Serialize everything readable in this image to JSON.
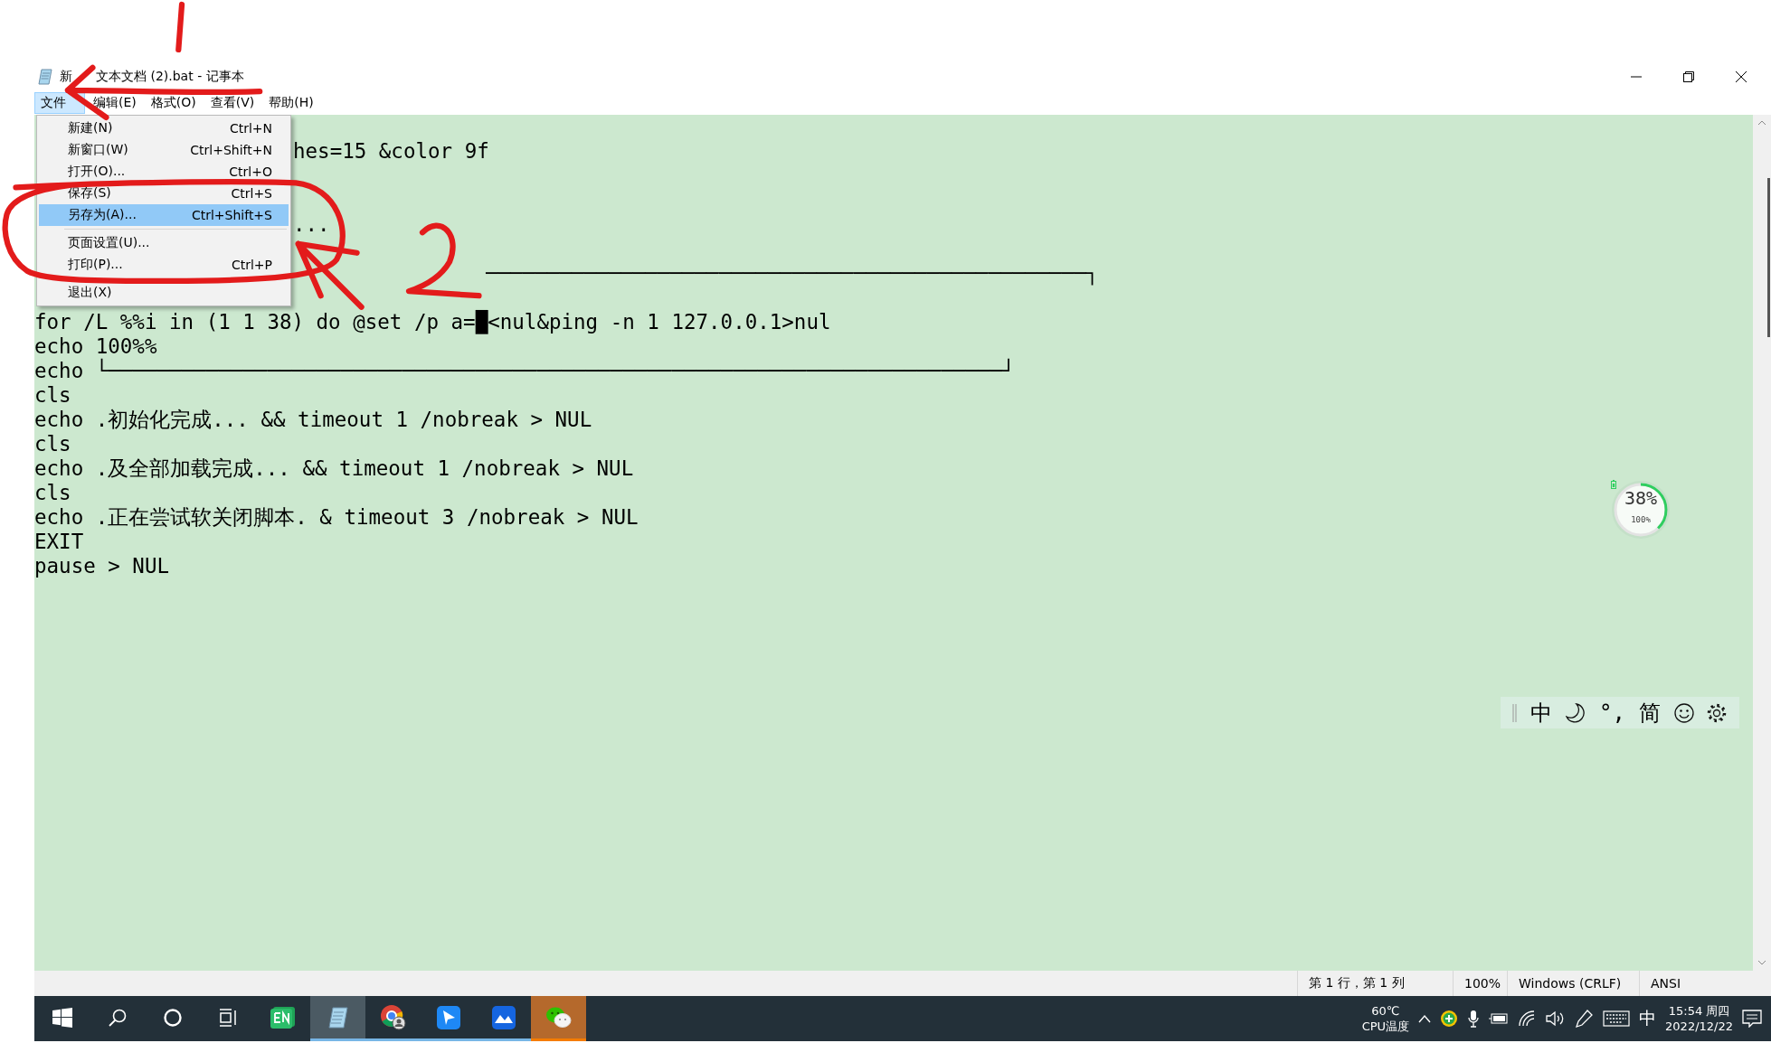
{
  "window": {
    "title": [
      "新",
      "文本文档 (2).bat - 记事本"
    ]
  },
  "menu_bar": [
    {
      "label": "文件",
      "selected": true
    },
    {
      "label": "编辑(E)",
      "selected": false
    },
    {
      "label": "格式(O)",
      "selected": false
    },
    {
      "label": "查看(V)",
      "selected": false
    },
    {
      "label": "帮助(H)",
      "selected": false
    }
  ],
  "file_menu": {
    "items": [
      {
        "kind": "item",
        "label": "新建(N)",
        "shortcut": "Ctrl+N",
        "selected": false
      },
      {
        "kind": "item",
        "label": "新窗口(W)",
        "shortcut": "Ctrl+Shift+N",
        "selected": false
      },
      {
        "kind": "item",
        "label": "打开(O)...",
        "shortcut": "Ctrl+O",
        "selected": false
      },
      {
        "kind": "item",
        "label": "保存(S)",
        "shortcut": "Ctrl+S",
        "selected": false
      },
      {
        "kind": "item",
        "label": "另存为(A)...",
        "shortcut": "Ctrl+Shift+S",
        "selected": true
      },
      {
        "kind": "separator"
      },
      {
        "kind": "item",
        "label": "页面设置(U)...",
        "selected": false
      },
      {
        "kind": "item",
        "label": "打印(P)...",
        "shortcut": "Ctrl+P",
        "selected": false
      },
      {
        "kind": "separator"
      },
      {
        "kind": "item",
        "label": "退出(X)",
        "selected": false
      }
    ]
  },
  "editor": {
    "lines": [
      {
        "kind": "blank"
      },
      {
        "kind": "covered",
        "text": "hes=15 &color 9f"
      },
      {
        "kind": "blank"
      },
      {
        "kind": "blank"
      },
      {
        "kind": "covered",
        "text": "..."
      },
      {
        "kind": "blank"
      },
      {
        "kind": "covered_wide",
        "text": "─────────────────────────────────────────────────┐"
      },
      {
        "kind": "blank"
      },
      {
        "kind": "code",
        "text": "for /L %%i in (1 1 38) do @set /p a=█<nul&ping -n 1 127.0.0.1>nul"
      },
      {
        "kind": "code",
        "text": "echo 100%%"
      },
      {
        "kind": "code",
        "text": "echo └─────────────────────────────────────────────────────────────────────────┘"
      },
      {
        "kind": "code",
        "text": "cls"
      },
      {
        "kind": "code",
        "text": "echo .初始化完成... && timeout 1 /nobreak > NUL"
      },
      {
        "kind": "code",
        "text": "cls"
      },
      {
        "kind": "code",
        "text": "echo .及全部加载完成... && timeout 1 /nobreak > NUL"
      },
      {
        "kind": "code",
        "text": "cls"
      },
      {
        "kind": "code",
        "text": "echo .正在尝试软关闭脚本. & timeout 3 /nobreak > NUL"
      },
      {
        "kind": "code",
        "text": "EXIT"
      },
      {
        "kind": "code",
        "text": "pause > NUL"
      }
    ]
  },
  "battery_widget": {
    "usage": "38%",
    "level": 0.38,
    "battery": "100%"
  },
  "ime_toolbar": {
    "mode": "中",
    "punctuation": "°,",
    "script": "简"
  },
  "status_bar": {
    "position": "第 1 行，第 1 列",
    "zoom": "100%",
    "line_ending": "Windows (CRLF)",
    "encoding": "ANSI"
  },
  "taskbar": {
    "buttons": [
      {
        "kind": "start"
      },
      {
        "kind": "search"
      },
      {
        "kind": "cortana"
      },
      {
        "kind": "task_view"
      }
    ],
    "apps": [
      {
        "kind": "en",
        "selected": false,
        "running": false,
        "flashing": false
      },
      {
        "kind": "notepad",
        "selected": true,
        "running": true,
        "flashing": false
      },
      {
        "kind": "chrome",
        "selected": false,
        "running": true,
        "flashing": false
      },
      {
        "kind": "feishu",
        "selected": false,
        "running": true,
        "flashing": false
      },
      {
        "kind": "lark",
        "selected": false,
        "running": true,
        "flashing": false
      },
      {
        "kind": "wechat",
        "selected": false,
        "running": false,
        "flashing": true
      }
    ],
    "tray": {
      "temperature": "60℃",
      "temperature_label": "CPU温度",
      "input_mode": "中",
      "time": "15:54 周四",
      "date": "2022/12/22"
    }
  }
}
